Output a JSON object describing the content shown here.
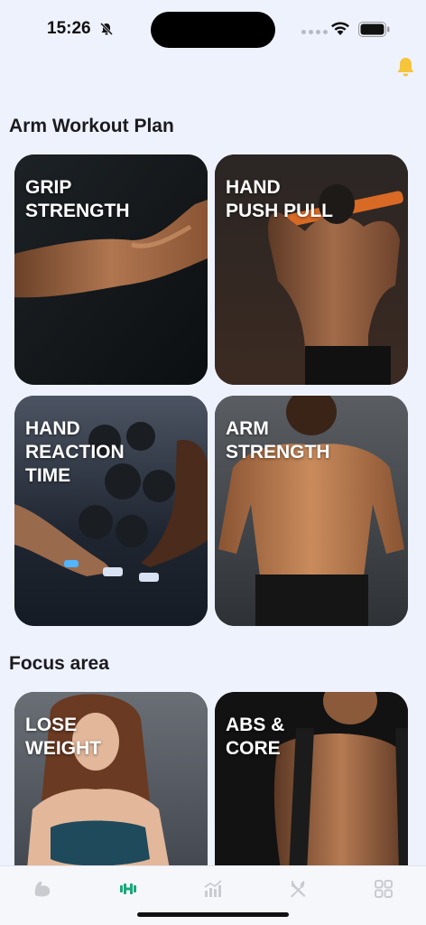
{
  "status": {
    "time": "15:26"
  },
  "colors": {
    "accent": "#1aa77a",
    "bell": "#f6c53b",
    "tab_inactive": "#c9cbd1",
    "background": "#eef2fd"
  },
  "sections": {
    "arm_plan_title": "Arm Workout Plan",
    "focus_title": "Focus area"
  },
  "cards": [
    {
      "label": "GRIP\nSTRENGTH"
    },
    {
      "label": "HAND\nPUSH PULL"
    },
    {
      "label": "HAND\nREACTION\nTIME"
    },
    {
      "label": "ARM\nSTRENGTH"
    },
    {
      "label": "LOSE\nWEIGHT"
    },
    {
      "label": "ABS &\nCORE"
    }
  ],
  "tabs": [
    {
      "icon": "biceps-icon",
      "active": false
    },
    {
      "icon": "dumbbell-icon",
      "active": true
    },
    {
      "icon": "stats-icon",
      "active": false
    },
    {
      "icon": "fork-knife-icon",
      "active": false
    },
    {
      "icon": "grid-icon",
      "active": false
    }
  ]
}
